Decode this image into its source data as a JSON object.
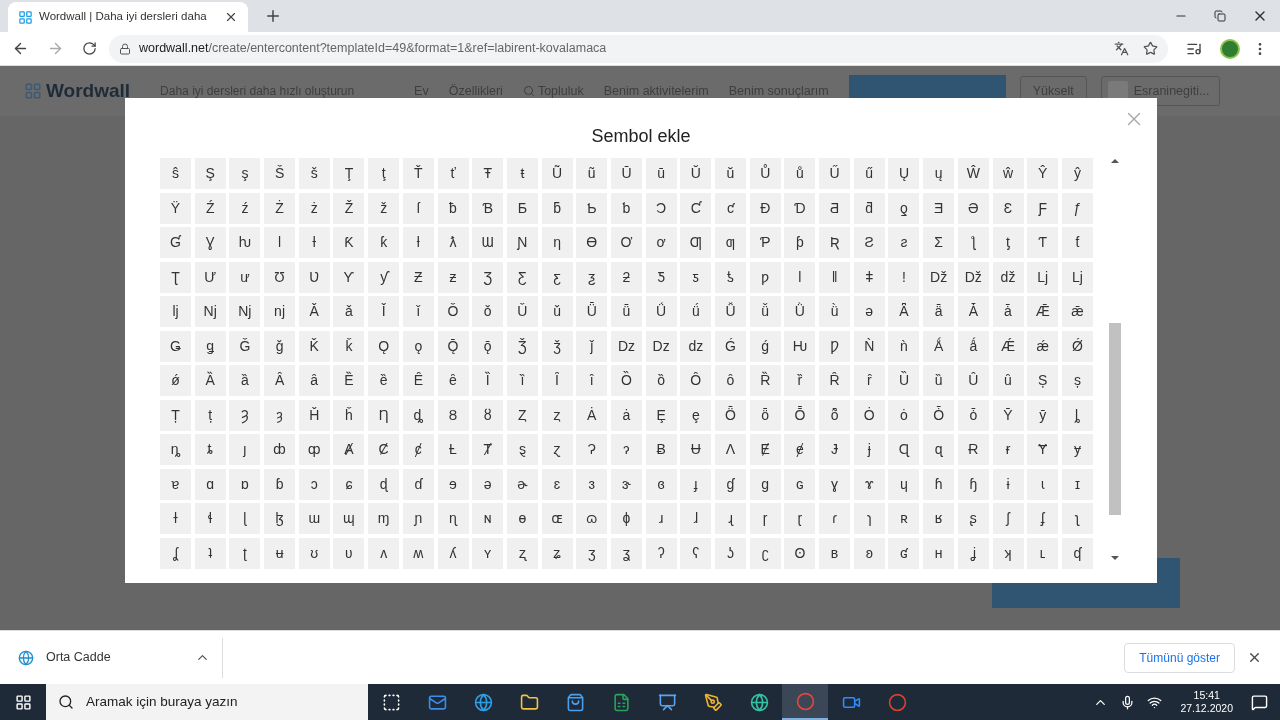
{
  "browser": {
    "tabs": [
      {
        "title": "Wordwall | Daha iyi dersleri daha",
        "selected": true
      }
    ],
    "url_host": "wordwall.net",
    "url_path": "/create/entercontent?templateId=49&format=1&ref=labirent-kovalamaca"
  },
  "page_header": {
    "logo": "Wordwall",
    "tagline": "Daha iyi dersleri daha hızlı oluşturun",
    "nav": [
      "Ev",
      "Özellikleri",
      "Topluluk",
      "Benim aktivitelerim",
      "Benim sonuçlarım"
    ],
    "upgrade": "Yükselt",
    "account": "Esraninegiti..."
  },
  "dialog": {
    "title": "Sembol ekle",
    "symbol_rows": [
      [
        "ŝ",
        "Ş",
        "ş",
        "Š",
        "š",
        "Ţ",
        "ţ",
        "Ť",
        "ť",
        "Ŧ",
        "ŧ",
        "Ũ",
        "ũ",
        "Ū",
        "ū",
        "Ŭ",
        "ŭ",
        "Ů",
        "ů",
        "Ű",
        "ű",
        "Ų",
        "ų",
        "Ŵ",
        "ŵ",
        "Ŷ",
        "ŷ"
      ],
      [
        "Ÿ",
        "Ź",
        "ź",
        "Ż",
        "ż",
        "Ž",
        "ž",
        "ſ",
        "ƀ",
        "Ɓ",
        "Ƃ",
        "ƃ",
        "Ƅ",
        "ƅ",
        "Ɔ",
        "Ƈ",
        "ƈ",
        "Ɖ",
        "Ɗ",
        "Ƌ",
        "ƌ",
        "ƍ",
        "Ǝ",
        "Ə",
        "Ɛ",
        "Ƒ",
        "ƒ"
      ],
      [
        "Ɠ",
        "Ɣ",
        "ƕ",
        "Ɩ",
        "Ɨ",
        "Ƙ",
        "ƙ",
        "ƚ",
        "ƛ",
        "Ɯ",
        "Ɲ",
        "ƞ",
        "Ɵ",
        "Ơ",
        "ơ",
        "Ƣ",
        "ƣ",
        "Ƥ",
        "ƥ",
        "Ʀ",
        "Ƨ",
        "ƨ",
        "Ʃ",
        "ƪ",
        "ƫ",
        "Ƭ",
        "ƭ"
      ],
      [
        "Ʈ",
        "Ư",
        "ư",
        "Ʊ",
        "Ʋ",
        "Ƴ",
        "ƴ",
        "Ƶ",
        "ƶ",
        "Ʒ",
        "Ƹ",
        "ƹ",
        "ƺ",
        "ƻ",
        "Ƽ",
        "ƽ",
        "ƾ",
        "ƿ",
        "ǀ",
        "ǁ",
        "ǂ",
        "ǃ",
        "Dž",
        "Dž",
        "dž",
        "Lj",
        "Lj"
      ],
      [
        "lj",
        "Nj",
        "Nj",
        "nj",
        "Ǎ",
        "ǎ",
        "Ǐ",
        "ǐ",
        "Ǒ",
        "ǒ",
        "Ǔ",
        "ǔ",
        "Ǖ",
        "ǖ",
        "Ǘ",
        "ǘ",
        "Ǚ",
        "ǚ",
        "Ǜ",
        "ǜ",
        "ǝ",
        "Ǟ",
        "ǟ",
        "Ǡ",
        "ǡ",
        "Ǣ",
        "ǣ"
      ],
      [
        "Ǥ",
        "ǥ",
        "Ǧ",
        "ǧ",
        "Ǩ",
        "ǩ",
        "Ǫ",
        "ǫ",
        "Ǭ",
        "ǭ",
        "Ǯ",
        "ǯ",
        "ǰ",
        "Dz",
        "Dz",
        "dz",
        "Ǵ",
        "ǵ",
        "Ƕ",
        "Ƿ",
        "Ǹ",
        "ǹ",
        "Ǻ",
        "ǻ",
        "Ǽ",
        "ǽ",
        "Ǿ"
      ],
      [
        "ǿ",
        "Ȁ",
        "ȁ",
        "Ȃ",
        "ȃ",
        "Ȅ",
        "ȅ",
        "Ȇ",
        "ȇ",
        "Ȉ",
        "ȉ",
        "Ȋ",
        "ȋ",
        "Ȍ",
        "ȍ",
        "Ȏ",
        "ȏ",
        "Ȑ",
        "ȑ",
        "Ȓ",
        "ȓ",
        "Ȕ",
        "ȕ",
        "Ȗ",
        "ȗ",
        "Ș",
        "ș"
      ],
      [
        "Ț",
        "ț",
        "Ȝ",
        "ȝ",
        "Ȟ",
        "ȟ",
        "Ƞ",
        "ȡ",
        "Ȣ",
        "ȣ",
        "Ȥ",
        "ȥ",
        "Ȧ",
        "ȧ",
        "Ȩ",
        "ȩ",
        "Ȫ",
        "ȫ",
        "Ȭ",
        "ȭ",
        "Ȯ",
        "ȯ",
        "Ȱ",
        "ȱ",
        "Ȳ",
        "ȳ",
        "ȴ"
      ],
      [
        "ȵ",
        "ȶ",
        "ȷ",
        "ȸ",
        "ȹ",
        "Ⱥ",
        "Ȼ",
        "ȼ",
        "Ƚ",
        "Ⱦ",
        "ȿ",
        "ɀ",
        "Ɂ",
        "ɂ",
        "Ƀ",
        "Ʉ",
        "Ʌ",
        "Ɇ",
        "ɇ",
        "Ɉ",
        "ɉ",
        "Ɋ",
        "ɋ",
        "Ɍ",
        "ɍ",
        "Ɏ",
        "ɏ"
      ],
      [
        "ɐ",
        "ɑ",
        "ɒ",
        "ɓ",
        "ɔ",
        "ɕ",
        "ɖ",
        "ɗ",
        "ɘ",
        "ə",
        "ɚ",
        "ɛ",
        "ɜ",
        "ɝ",
        "ɞ",
        "ɟ",
        "ɠ",
        "ɡ",
        "ɢ",
        "ɣ",
        "ɤ",
        "ɥ",
        "ɦ",
        "ɧ",
        "ɨ",
        "ɩ",
        "ɪ"
      ],
      [
        "ɫ",
        "ɬ",
        "ɭ",
        "ɮ",
        "ɯ",
        "ɰ",
        "ɱ",
        "ɲ",
        "ɳ",
        "ɴ",
        "ɵ",
        "ɶ",
        "ɷ",
        "ɸ",
        "ɹ",
        "ɺ",
        "ɻ",
        "ɼ",
        "ɽ",
        "ɾ",
        "ɿ",
        "ʀ",
        "ʁ",
        "ʂ",
        "ʃ",
        "ʄ",
        "ʅ"
      ],
      [
        "ʆ",
        "ʇ",
        "ʈ",
        "ʉ",
        "ʊ",
        "ʋ",
        "ʌ",
        "ʍ",
        "ʎ",
        "ʏ",
        "ʐ",
        "ʑ",
        "ʒ",
        "ʓ",
        "ʔ",
        "ʕ",
        "ʖ",
        "ʗ",
        "ʘ",
        "ʙ",
        "ʚ",
        "ʛ",
        "ʜ",
        "ʝ",
        "ʞ",
        "ʟ",
        "ʠ"
      ]
    ]
  },
  "download_bar": {
    "file": "Orta Cadde",
    "show_all": "Tümünü göster"
  },
  "taskbar": {
    "search_placeholder": "Aramak için buraya yazın",
    "time": "15:41",
    "date": "27.12.2020",
    "apps": [
      {
        "kind": "taskview",
        "selected": false
      },
      {
        "kind": "mail",
        "selected": false
      },
      {
        "kind": "ie",
        "selected": false
      },
      {
        "kind": "folder",
        "selected": false
      },
      {
        "kind": "store",
        "selected": false
      },
      {
        "kind": "excel",
        "selected": false
      },
      {
        "kind": "board",
        "selected": false
      },
      {
        "kind": "pen",
        "selected": false
      },
      {
        "kind": "edge",
        "selected": false
      },
      {
        "kind": "chrome",
        "selected": true
      },
      {
        "kind": "zoom",
        "selected": false
      },
      {
        "kind": "red",
        "selected": false
      }
    ]
  }
}
